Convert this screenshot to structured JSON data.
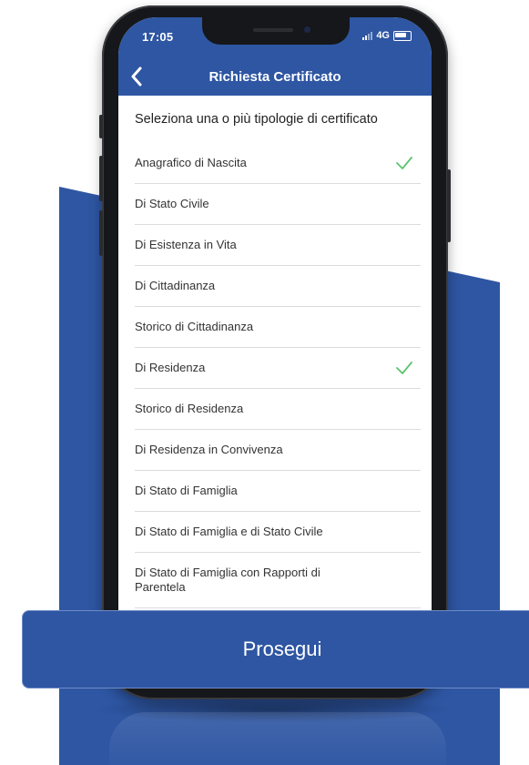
{
  "status_bar": {
    "time": "17:05",
    "network": "4G"
  },
  "navbar": {
    "back_icon": "chevron-left-icon",
    "title": "Richiesta Certificato"
  },
  "instruction": "Seleziona una o più tipologie di certificato",
  "certificates": [
    {
      "label": "Anagrafico di Nascita",
      "selected": true
    },
    {
      "label": "Di Stato Civile",
      "selected": false
    },
    {
      "label": "Di Esistenza in Vita",
      "selected": false
    },
    {
      "label": "Di Cittadinanza",
      "selected": false
    },
    {
      "label": "Storico di Cittadinanza",
      "selected": false
    },
    {
      "label": "Di Residenza",
      "selected": true
    },
    {
      "label": "Storico di Residenza",
      "selected": false
    },
    {
      "label": "Di Residenza in Convivenza",
      "selected": false
    },
    {
      "label": "Di Stato di Famiglia",
      "selected": false
    },
    {
      "label": "Di Stato di Famiglia e di Stato Civile",
      "selected": false
    },
    {
      "label": "Di Stato di Famiglia con Rapporti di Parentela",
      "selected": false
    }
  ],
  "cta": {
    "label": "Prosegui"
  },
  "colors": {
    "primary": "#2e56a3",
    "check": "#5cc46f"
  }
}
